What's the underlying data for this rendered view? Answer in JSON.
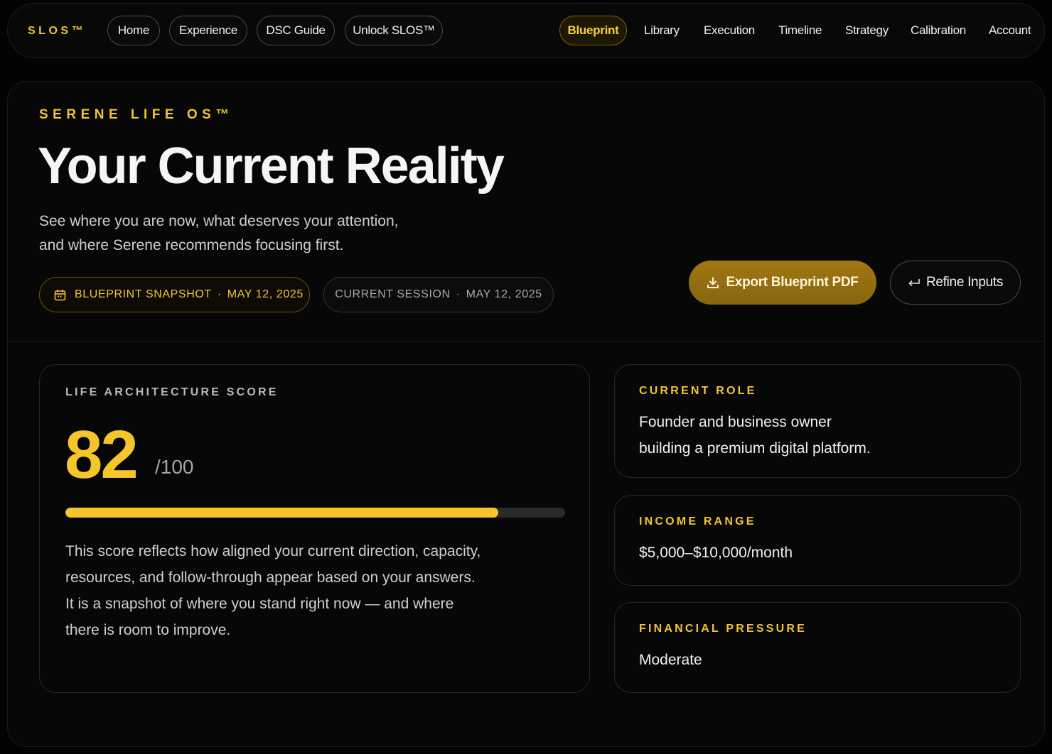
{
  "nav": {
    "brand": "SLOS™",
    "left_items": [
      "Home",
      "Experience",
      "DSC Guide",
      "Unlock SLOS™"
    ],
    "active_item": "Blueprint",
    "right_items": [
      "Library",
      "Execution",
      "Timeline",
      "Strategy",
      "Calibration",
      "Account"
    ]
  },
  "header": {
    "eyebrow": "SERENE LIFE OS™",
    "title": "Your Current Reality",
    "subtitle_line1": "See where you are now, what deserves your attention,",
    "subtitle_line2": "and where Serene recommends focusing first.",
    "snapshot_label": "BLUEPRINT SNAPSHOT",
    "snapshot_date": "MAY 12, 2025",
    "session_label": "CURRENT SESSION",
    "session_date": "MAY 12, 2025",
    "dot": "·"
  },
  "actions": {
    "export_label": "Export Blueprint PDF",
    "refine_label": "Refine Inputs"
  },
  "score": {
    "label": "LIFE ARCHITECTURE SCORE",
    "value": "82",
    "max": "/100",
    "progress": 0.866,
    "desc_line1": "This score reflects how aligned your current direction, capacity,",
    "desc_line2": "resources, and follow-through appear based on your answers.",
    "desc_line3": "It is a snapshot of where you stand right now — and where",
    "desc_line4": "there is room to improve."
  },
  "cards": {
    "role_label": "CURRENT ROLE",
    "role_line1": "Founder and business owner",
    "role_line2": "building a premium digital platform.",
    "income_label": "INCOME RANGE",
    "income_value": "$5,000–$10,000/month",
    "pressure_label": "FINANCIAL PRESSURE",
    "pressure_value": "Moderate"
  },
  "colors": {
    "accent": "#f2c531",
    "background": "#030303",
    "button_gold": "#8e6b11"
  },
  "icons": {
    "snapshot": "calendar-icon",
    "export": "download-icon",
    "refine": "return-arrow-icon"
  }
}
